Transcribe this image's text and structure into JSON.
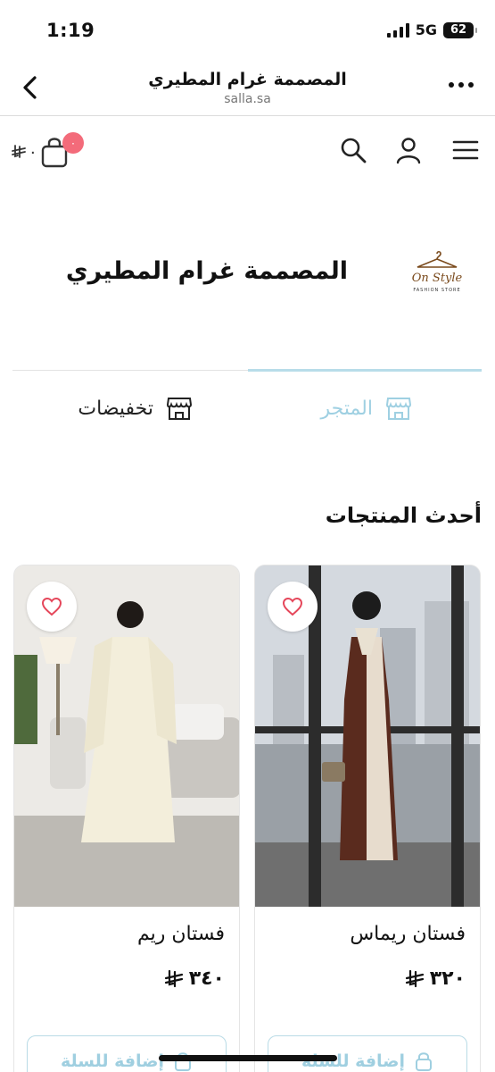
{
  "status": {
    "time": "1:19",
    "network": "5G",
    "battery": "62"
  },
  "browser": {
    "title": "المصممة غرام المطيري",
    "url": "salla.sa"
  },
  "store": {
    "name": "المصممة غرام المطيري",
    "logo_text": "On Style",
    "logo_subtext": "FASHION STORE",
    "cart_count": "٠",
    "cart_total": "٠"
  },
  "tabs": [
    {
      "label": "المتجر",
      "active": true
    },
    {
      "label": "تخفيضات",
      "active": false
    }
  ],
  "section": {
    "title": "أحدث المنتجات"
  },
  "products": [
    {
      "name": "فستان ريماس",
      "price": "٣٢٠",
      "button": "إضافة للسلة"
    },
    {
      "name": "فستان ريم",
      "price": "٣٤٠",
      "button": "إضافة للسلة"
    }
  ],
  "colors": {
    "accent": "#9fd0e2",
    "badge": "#f36b7a"
  }
}
